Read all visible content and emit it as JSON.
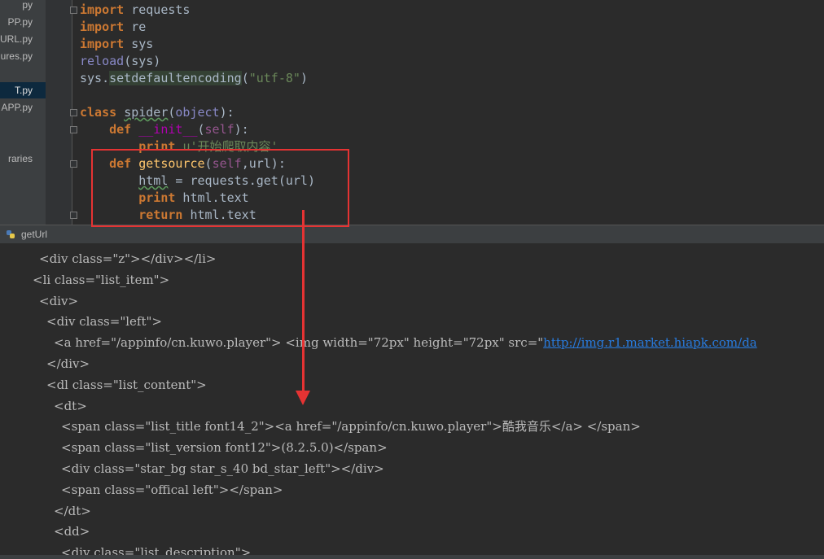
{
  "project": {
    "items": [
      {
        "label": "py"
      },
      {
        "label": "PP.py"
      },
      {
        "label": "URL.py"
      },
      {
        "label": "ures.py"
      },
      {
        "label": "T.py",
        "selected": true
      },
      {
        "label": "APP.py"
      },
      {
        "label": "raries"
      }
    ]
  },
  "editor": {
    "lines": [
      [
        {
          "t": "import",
          "c": "kw"
        },
        {
          "t": " requests"
        }
      ],
      [
        {
          "t": "import",
          "c": "kw"
        },
        {
          "t": " re"
        }
      ],
      [
        {
          "t": "import",
          "c": "kw"
        },
        {
          "t": " sys"
        }
      ],
      [
        {
          "t": "reload",
          "c": "bi"
        },
        {
          "t": "(sys)"
        }
      ],
      [
        {
          "t": "sys."
        },
        {
          "t": "setdefaultencoding",
          "c": "hl"
        },
        {
          "t": "("
        },
        {
          "t": "\"utf-8\"",
          "c": "str"
        },
        {
          "t": ")"
        }
      ],
      [],
      [
        {
          "t": "class",
          "c": "kw"
        },
        {
          "t": " "
        },
        {
          "t": "spider",
          "c": "under"
        },
        {
          "t": "("
        },
        {
          "t": "object",
          "c": "bi"
        },
        {
          "t": "):"
        }
      ],
      [
        {
          "t": "    "
        },
        {
          "t": "def",
          "c": "kw"
        },
        {
          "t": " "
        },
        {
          "t": "__init__",
          "c": "mg"
        },
        {
          "t": "("
        },
        {
          "t": "self",
          "c": "self"
        },
        {
          "t": "):"
        }
      ],
      [
        {
          "t": "        "
        },
        {
          "t": "print",
          "c": "kw"
        },
        {
          "t": " "
        },
        {
          "t": "u'开始爬取内容'",
          "c": "str"
        }
      ],
      [
        {
          "t": "    "
        },
        {
          "t": "def",
          "c": "kw"
        },
        {
          "t": " "
        },
        {
          "t": "getsource",
          "c": "fn"
        },
        {
          "t": "("
        },
        {
          "t": "self",
          "c": "self"
        },
        {
          "t": ",url):"
        }
      ],
      [
        {
          "t": "        "
        },
        {
          "t": "html",
          "c": "under"
        },
        {
          "t": " = requests.get(url)"
        }
      ],
      [
        {
          "t": "        "
        },
        {
          "t": "print",
          "c": "kw"
        },
        {
          "t": " html.text"
        }
      ],
      [
        {
          "t": "        "
        },
        {
          "t": "return",
          "c": "kw"
        },
        {
          "t": " html.text"
        }
      ]
    ]
  },
  "console": {
    "title": "getUrl",
    "lines": [
      {
        "indent": 48,
        "parts": [
          {
            "t": "<div class=\"z\"></div></li>"
          }
        ]
      },
      {
        "indent": 40,
        "parts": [
          {
            "t": "<li class=\"list_item\">"
          }
        ]
      },
      {
        "indent": 48,
        "parts": [
          {
            "t": "<div>"
          }
        ]
      },
      {
        "indent": 57,
        "parts": [
          {
            "t": "<div class=\"left\">"
          }
        ]
      },
      {
        "indent": 66,
        "parts": [
          {
            "t": "<a href=\"/appinfo/cn.kuwo.player\"> <img width=\"72px\" height=\"72px\" src=\""
          },
          {
            "t": "http://img.r1.market.hiapk.com/da",
            "c": "link"
          }
        ]
      },
      {
        "indent": 57,
        "parts": [
          {
            "t": "</div>"
          }
        ]
      },
      {
        "indent": 57,
        "parts": [
          {
            "t": "<dl class=\"list_content\">"
          }
        ]
      },
      {
        "indent": 66,
        "parts": [
          {
            "t": "<dt>"
          }
        ]
      },
      {
        "indent": 75,
        "parts": [
          {
            "t": "<span class=\"list_title font14_2\"><a href=\"/appinfo/cn.kuwo.player\">酷我音乐</a> </span>"
          }
        ]
      },
      {
        "indent": 75,
        "parts": [
          {
            "t": "<span class=\"list_version font12\">(8.2.5.0)</span>"
          }
        ]
      },
      {
        "indent": 75,
        "parts": [
          {
            "t": "<div class=\"star_bg star_s_40 bd_star_left\"></div>"
          }
        ]
      },
      {
        "indent": 75,
        "parts": [
          {
            "t": "<span class=\"offical left\"></span>"
          }
        ]
      },
      {
        "indent": 66,
        "parts": [
          {
            "t": "</dt>"
          }
        ]
      },
      {
        "indent": 66,
        "parts": [
          {
            "t": "<dd>"
          }
        ]
      },
      {
        "indent": 75,
        "parts": [
          {
            "t": "<div class=\"list_description\">"
          }
        ]
      }
    ]
  },
  "colors": {
    "annotation": "#e53333"
  }
}
